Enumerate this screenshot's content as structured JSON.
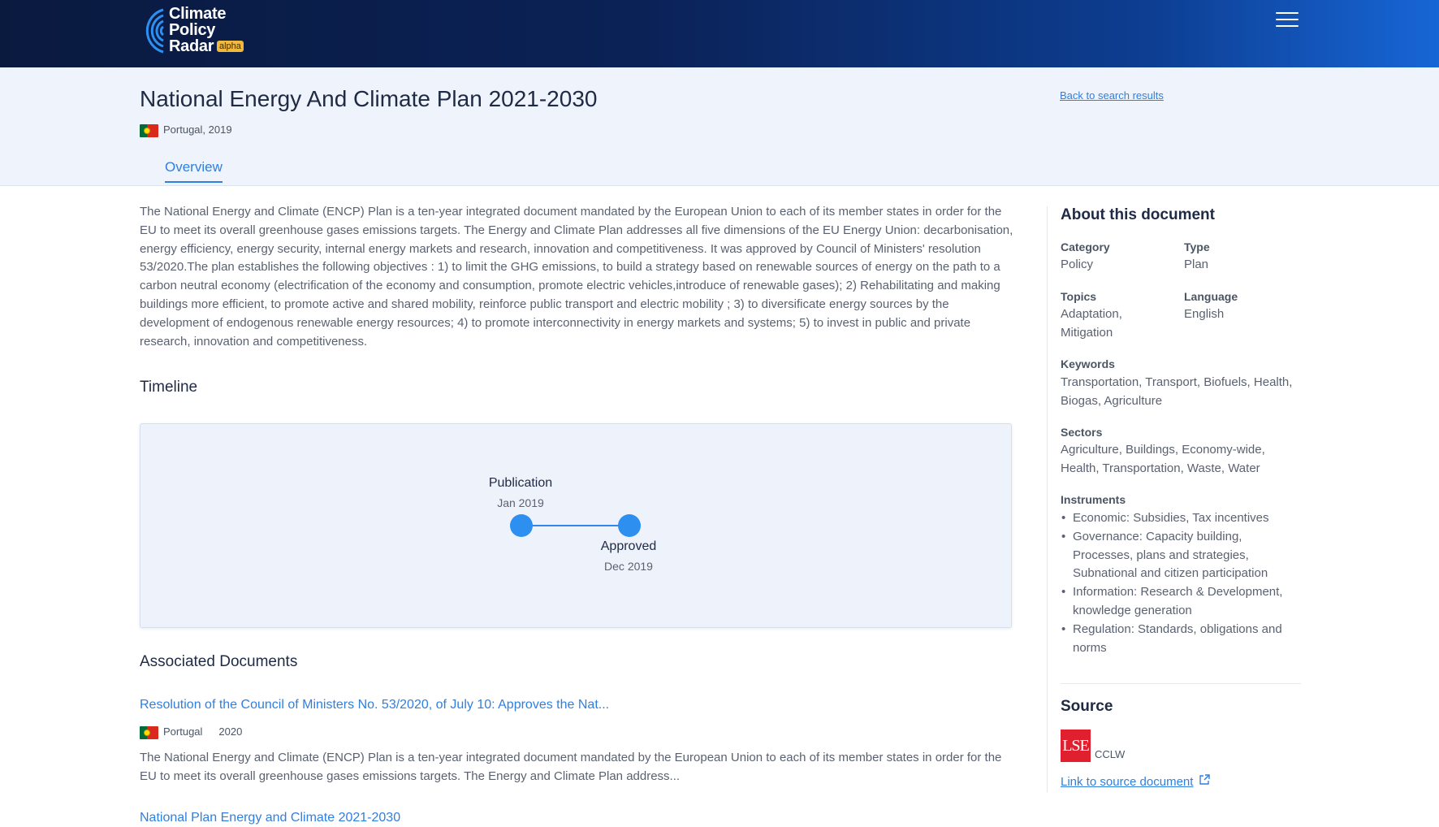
{
  "header": {
    "logo_lines": [
      "Climate",
      "Policy",
      "Radar"
    ],
    "badge": "alpha",
    "menu_icon": "hamburger-menu-icon"
  },
  "document": {
    "title": "National Energy And Climate Plan 2021-2030",
    "geography": "Portugal, 2019",
    "flag_icon": "portugal-flag-icon",
    "back_link": "Back to search results",
    "tabs": [
      {
        "label": "Overview",
        "active": true
      }
    ],
    "summary": "The National Energy and Climate (ENCP) Plan is a ten-year integrated document mandated by the European Union to each of its member states in order for the EU to meet its overall greenhouse gases emissions targets.  The Energy and Climate Plan addresses all five dimensions of the EU Energy Union: decarbonisation, energy efficiency, energy security, internal energy markets and research, innovation and competitiveness. It was approved by Council of Ministers' resolution 53/2020.The plan establishes the following objectives : 1) to limit the GHG emissions, to build a strategy based on renewable sources of energy on the path to a carbon neutral economy (electrification of the economy and consumption, promote electric vehicles,introduce of renewable gases); 2) Rehabilitating and making buildings more efficient, to promote active and shared mobility, reinforce public transport and electric mobility ; 3) to diversificate energy sources by the development of endogenous renewable energy resources; 4) to promote interconnectivity in energy markets and systems; 5) to invest in public and private research, innovation and competitiveness."
  },
  "timeline": {
    "heading": "Timeline",
    "events": [
      {
        "label": "Publication",
        "date": "Jan 2019"
      },
      {
        "label": "Approved",
        "date": "Dec 2019"
      }
    ]
  },
  "associated": {
    "heading": "Associated Documents",
    "items": [
      {
        "title": "Resolution of the Council of Ministers No. 53/2020, of July 10: Approves the Nat...",
        "country": "Portugal",
        "year": "2020",
        "description": "The National Energy and Climate (ENCP) Plan is a ten-year integrated document mandated by the European Union to each of its member states in order for the EU to meet its overall greenhouse gases emissions targets.  The Energy and Climate Plan address..."
      },
      {
        "title": "National Plan Energy and Climate 2021-2030"
      }
    ]
  },
  "about": {
    "heading": "About this document",
    "category_label": "Category",
    "category_value": "Policy",
    "type_label": "Type",
    "type_value": "Plan",
    "topics_label": "Topics",
    "topics_value_1": "Adaptation,",
    "topics_value_2": "Mitigation",
    "language_label": "Language",
    "language_value": "English",
    "keywords_label": "Keywords",
    "keywords_value_1": "Transportation, Transport, Biofuels, Health,",
    "keywords_value_2": "Biogas, Agriculture",
    "sectors_label": "Sectors",
    "sectors_value_1": "Agriculture, Buildings, Economy-wide,",
    "sectors_value_2": "Health, Transportation, Waste, Water",
    "instruments_label": "Instruments",
    "instruments": [
      "Economic: Subsidies, Tax incentives",
      "Governance: Capacity building, Processes, plans and strategies, Subnational and citizen participation",
      "Information: Research & Development, knowledge generation",
      "Regulation: Standards, obligations and norms"
    ]
  },
  "source": {
    "heading": "Source",
    "logo_text": "LSE",
    "org": "CCLW",
    "link": "Link to source document",
    "link_icon": "external-link-icon"
  }
}
